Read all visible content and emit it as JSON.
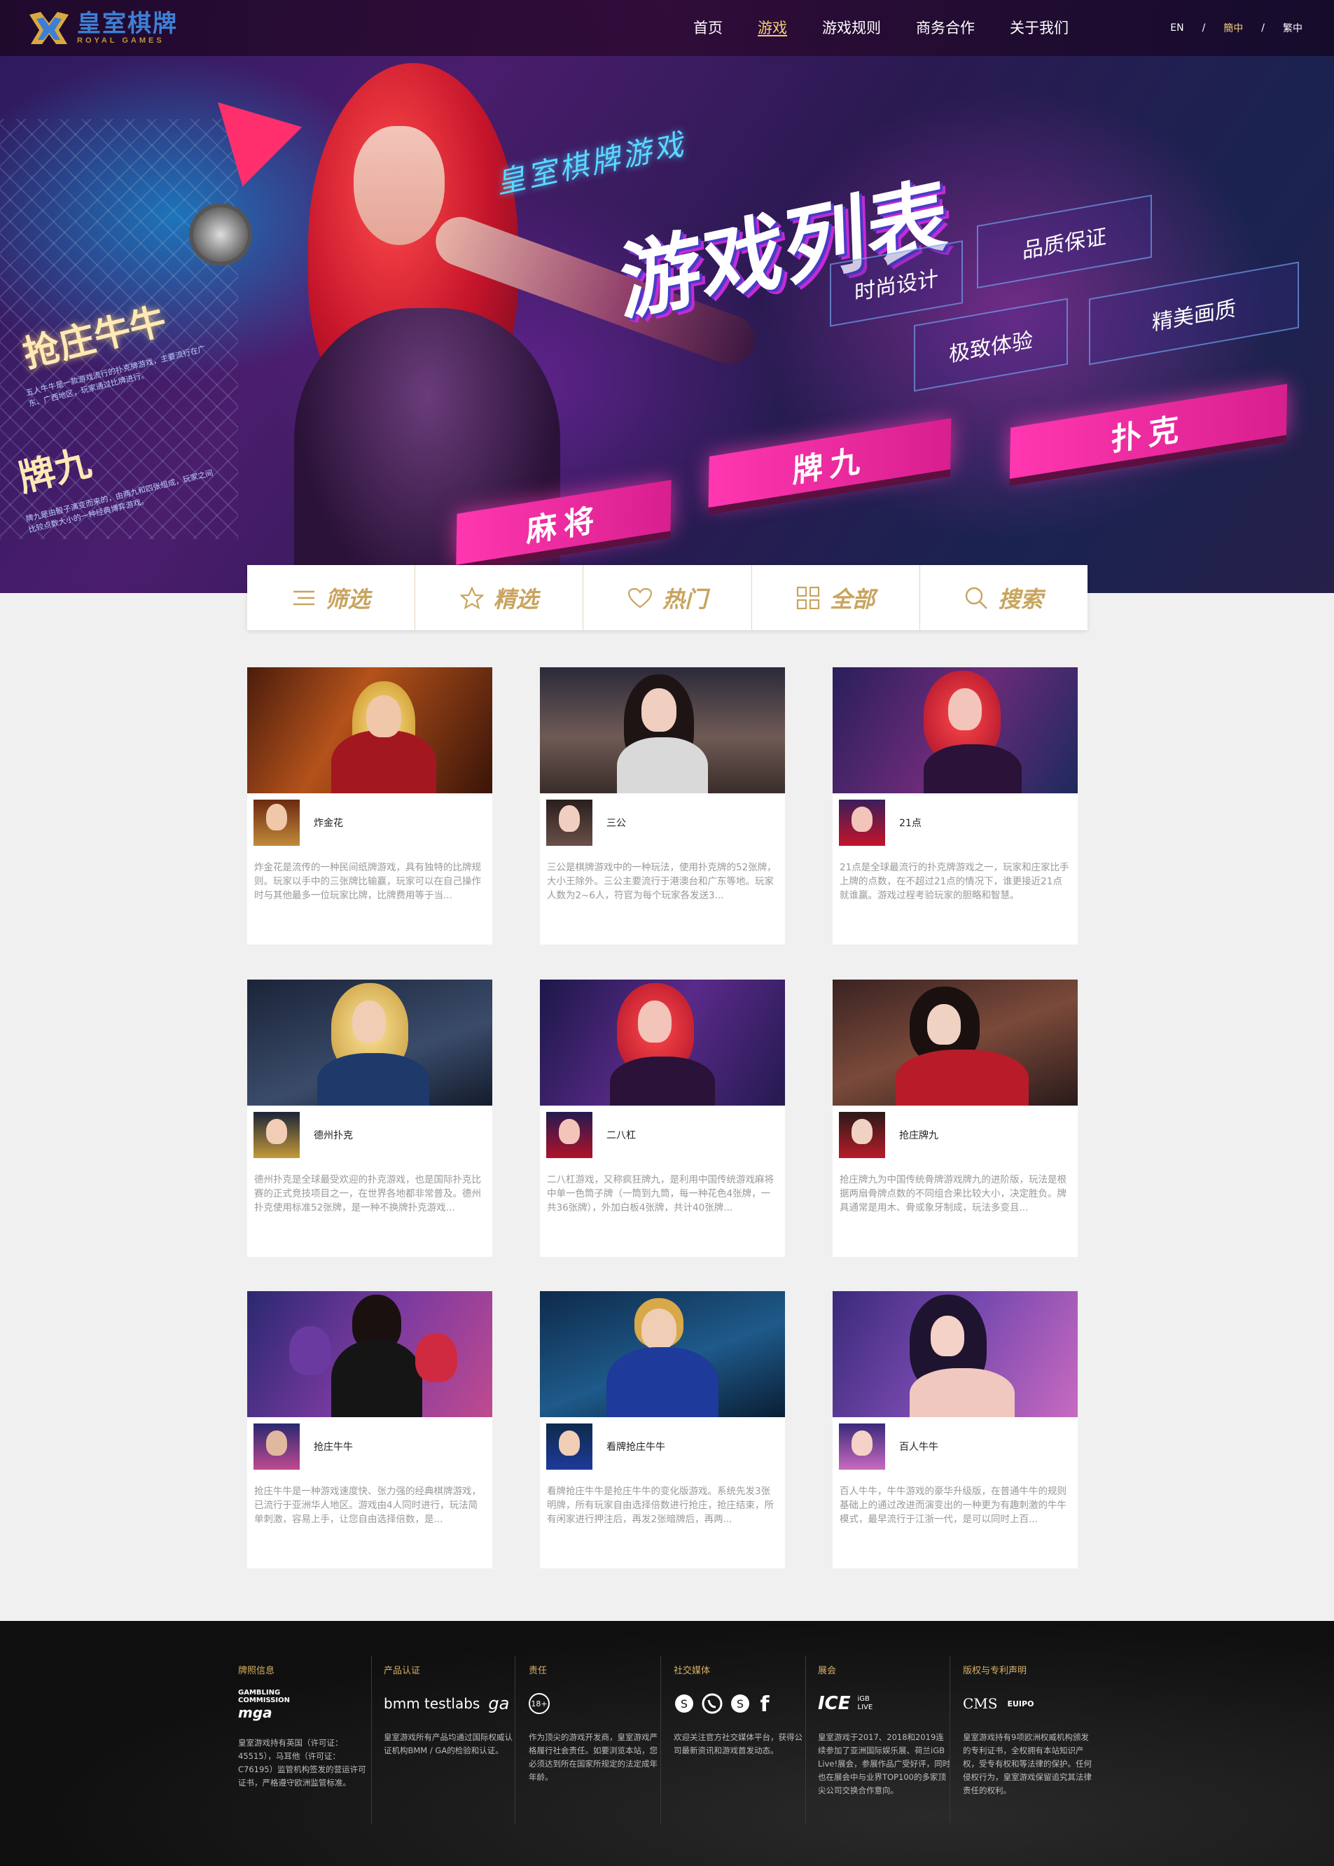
{
  "header": {
    "logo_cn": "皇室棋牌",
    "logo_en": "ROYAL GAMES",
    "nav": [
      "首页",
      "游戏",
      "游戏规则",
      "商务合作",
      "关于我们"
    ],
    "active_nav": "游戏",
    "languages": [
      "EN",
      "簡中",
      "繁中"
    ],
    "separators": [
      "/",
      "/"
    ]
  },
  "banner": {
    "subtitle": "皇室棋牌游戏",
    "title": "游戏列表",
    "tags": [
      "品质保证",
      "时尚设计",
      "精美画质",
      "极致体验"
    ],
    "buttons": [
      "扑克",
      "牌九",
      "麻将"
    ],
    "left_title_1": "抢庄牛牛",
    "left_text_1": "五人牛牛是一款游戏流行的扑克牌游戏，主要流行在广东、广西地区，玩家通过比牌进行。",
    "left_title_2": "牌九",
    "left_text_2": "牌九是由骰子演变而来的，由两九和四张组成，玩家之间比较点数大小的一种经典博弈游戏。"
  },
  "tabs": [
    {
      "label": "筛选",
      "icon": "list-icon"
    },
    {
      "label": "精选",
      "icon": "star-icon"
    },
    {
      "label": "热门",
      "icon": "heart-icon"
    },
    {
      "label": "全部",
      "icon": "grid-icon"
    },
    {
      "label": "搜索",
      "icon": "search-icon"
    }
  ],
  "games": [
    {
      "name": "炸金花",
      "desc": "炸金花是流传的一种民间纸牌游戏，具有独特的比牌规则。玩家以手中的三张牌比输赢，玩家可以在自己操作时与其他最多一位玩家比牌，比牌费用等于当..."
    },
    {
      "name": "三公",
      "desc": "三公是棋牌游戏中的一种玩法，使用扑克牌的52张牌，大小王除外。三公主要流行于港澳台和广东等地。玩家人数为2~6人，符官为每个玩家各发送3..."
    },
    {
      "name": "21点",
      "desc": "21点是全球最流行的扑克牌游戏之一，玩家和庄家比手上牌的点数，在不超过21点的情况下，谁更接近21点就谁赢。游戏过程考验玩家的胆略和智慧。"
    },
    {
      "name": "德州扑克",
      "desc": "德州扑克是全球最受欢迎的扑克游戏，也是国际扑克比赛的正式竞技项目之一，在世界各地都非常普及。德州扑克使用标准52张牌，是一种不换牌扑克游戏..."
    },
    {
      "name": "二八杠",
      "desc": "二八杠游戏，又称疯狂牌九，是利用中国传统游戏麻将中单一色筒子牌（一筒到九筒，每一种花色4张牌，一共36张牌），外加白板4张牌，共计40张牌..."
    },
    {
      "name": "抢庄牌九",
      "desc": "抢庄牌九为中国传统骨牌游戏牌九的进阶版，玩法是根据两扇骨牌点数的不同组合来比较大小，决定胜负。牌具通常是用木、骨或象牙制成，玩法多变且..."
    },
    {
      "name": "抢庄牛牛",
      "desc": "抢庄牛牛是一种游戏速度快、张力强的经典棋牌游戏，已流行于亚洲华人地区。游戏由4人同时进行，玩法简单刺激，容易上手，让您自由选择倍数，是..."
    },
    {
      "name": "看牌抢庄牛牛",
      "desc": "看牌抢庄牛牛是抢庄牛牛的变化版游戏。系统先发3张明牌，所有玩家自由选择倍数进行抢庄，抢庄结束，所有闲家进行押注后，再发2张暗牌后，再两..."
    },
    {
      "name": "百人牛牛",
      "desc": "百人牛牛，牛牛游戏的豪华升级版，在普通牛牛的规则基础上的通过改进而演变出的一种更为有趣刺激的牛牛模式，最早流行于江浙一代，是可以同时上百..."
    }
  ],
  "footer": {
    "columns": [
      {
        "title": "牌照信息",
        "logos": [
          "GAMBLING COMMISSION",
          "mga"
        ],
        "text": "皇室游戏持有英国（许可证：45515），马耳他（许可证：C76195）监管机构签发的营运许可证书，严格遵守欧洲监管标准。"
      },
      {
        "title": "产品认证",
        "logos": [
          "bmm testlabs",
          "ga"
        ],
        "text": "皇室游戏所有产品均通过国际权威认证机构BMM / GA的检验和认证。"
      },
      {
        "title": "责任",
        "logos": [
          "18+"
        ],
        "text": "作为顶尖的游戏开发商，皇室游戏严格履行社会责任。如要浏览本站，您必须达到所在国家所规定的法定成年年龄。"
      },
      {
        "title": "社交媒体",
        "logos": [
          "skype",
          "whatsapp",
          "skype",
          "facebook"
        ],
        "text": "欢迎关注官方社交媒体平台，获得公司最新资讯和游戏首发动态。"
      },
      {
        "title": "展会",
        "logos": [
          "ICE",
          "iGB LIVE"
        ],
        "text": "皇室游戏于2017、2018和2019连续参加了亚洲国际娱乐展、荷兰iGB Live!展会，参展作品广受好评，同时也在展会中与业界TOP100的多家顶尖公司交换合作意向。"
      },
      {
        "title": "版权与专利声明",
        "logos": [
          "CMS",
          "EUIPO"
        ],
        "text": "皇室游戏持有9项欧洲权威机构颁发的专利证书，全权拥有本站知识产权，受专有权和等法律的保护。任何侵权行为，皇室游戏保留追究其法律责任的权利。"
      }
    ]
  }
}
